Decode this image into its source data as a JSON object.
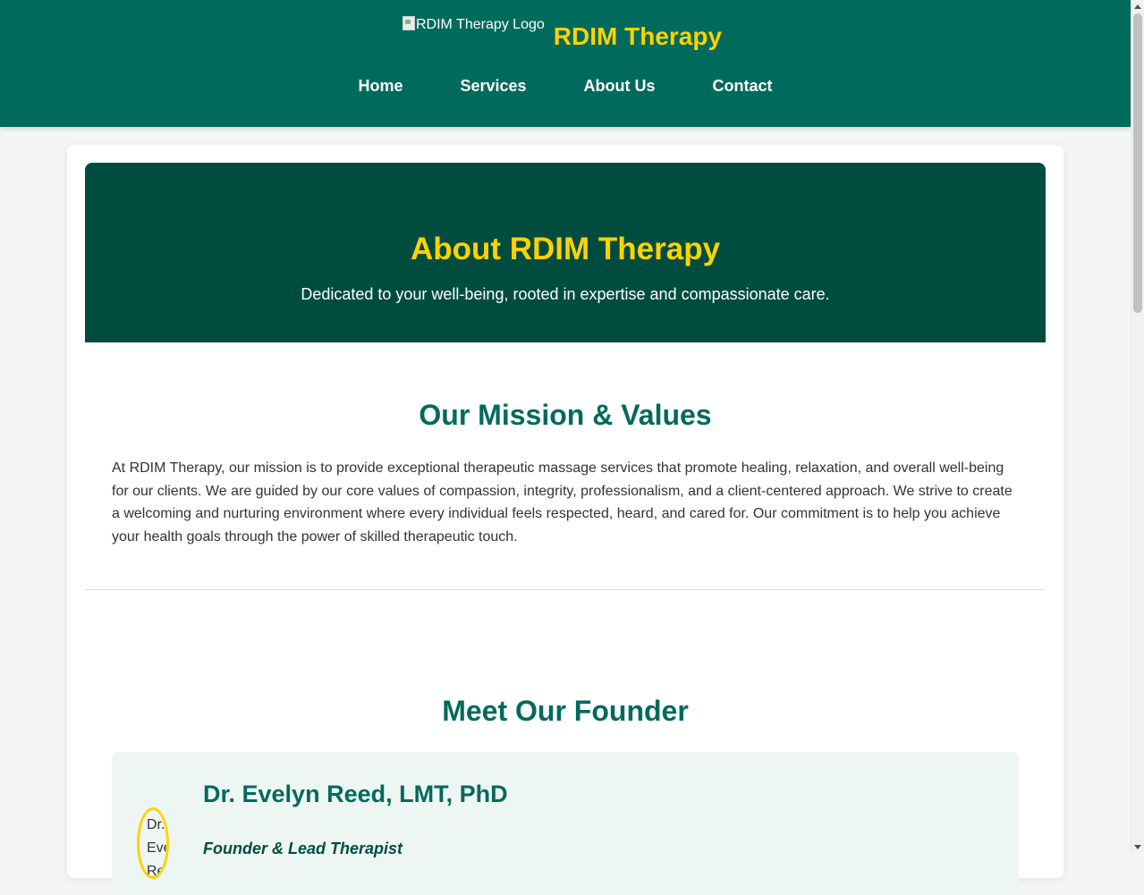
{
  "header": {
    "logo_alt": "RDIM Therapy Logo",
    "site_title": "RDIM Therapy",
    "nav": [
      "Home",
      "Services",
      "About Us",
      "Contact"
    ]
  },
  "hero": {
    "title": "About RDIM Therapy",
    "subtitle": "Dedicated to your well-being, rooted in expertise and compassionate care."
  },
  "mission": {
    "title": "Our Mission & Values",
    "text": "At RDIM Therapy, our mission is to provide exceptional therapeutic massage services that promote healing, relaxation, and overall well-being for our clients. We are guided by our core values of compassion, integrity, professionalism, and a client-centered approach. We strive to create a welcoming and nurturing environment where every individual feels respected, heard, and cared for. Our commitment is to help you achieve your health goals through the power of skilled therapeutic touch."
  },
  "founder": {
    "section_title": "Meet Our Founder",
    "photo_alt": "Dr. Evelyn Reed",
    "name": "Dr. Evelyn Reed, LMT, PhD",
    "role": "Founder & Lead Therapist"
  },
  "colors": {
    "header_bg": "#006a5c",
    "hero_bg": "#004d40",
    "accent": "#ffd200",
    "heading": "#006a5c"
  }
}
